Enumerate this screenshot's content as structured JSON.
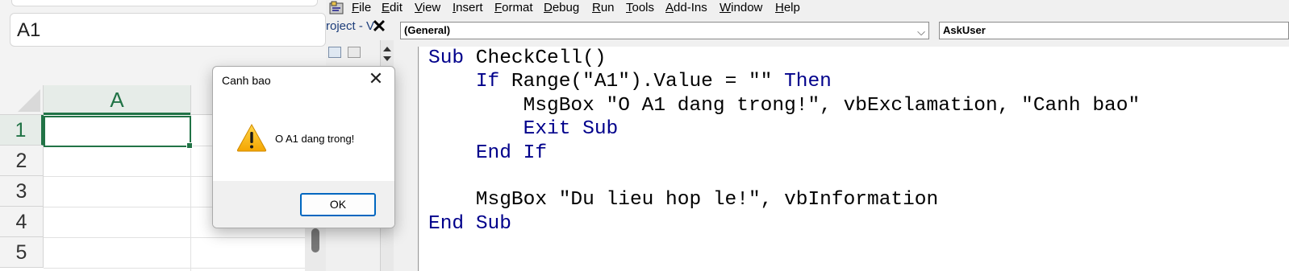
{
  "excel": {
    "name_box": "A1",
    "column_header": "A",
    "row_headers": [
      "1",
      "2",
      "3",
      "4",
      "5"
    ]
  },
  "vbe": {
    "menu": [
      "File",
      "Edit",
      "View",
      "Insert",
      "Format",
      "Debug",
      "Run",
      "Tools",
      "Add-Ins",
      "Window",
      "Help"
    ],
    "project_title": "roject - V",
    "object_combo": "(General)",
    "procedure_combo": "AskUser",
    "code_lines": [
      "Sub CheckCell()",
      "    If Range(\"A1\").Value = \"\" Then",
      "        MsgBox \"O A1 dang trong!\", vbExclamation, \"Canh bao\"",
      "        Exit Sub",
      "    End If",
      "",
      "    MsgBox \"Du lieu hop le!\", vbInformation",
      "End Sub"
    ]
  },
  "msgbox": {
    "title": "Canh bao",
    "message": "O A1 dang trong!",
    "ok_label": "OK",
    "icon": "warning-icon"
  },
  "colors": {
    "excel_green": "#217346",
    "vba_keyword": "#00008b",
    "dialog_button_border": "#0067c0"
  }
}
